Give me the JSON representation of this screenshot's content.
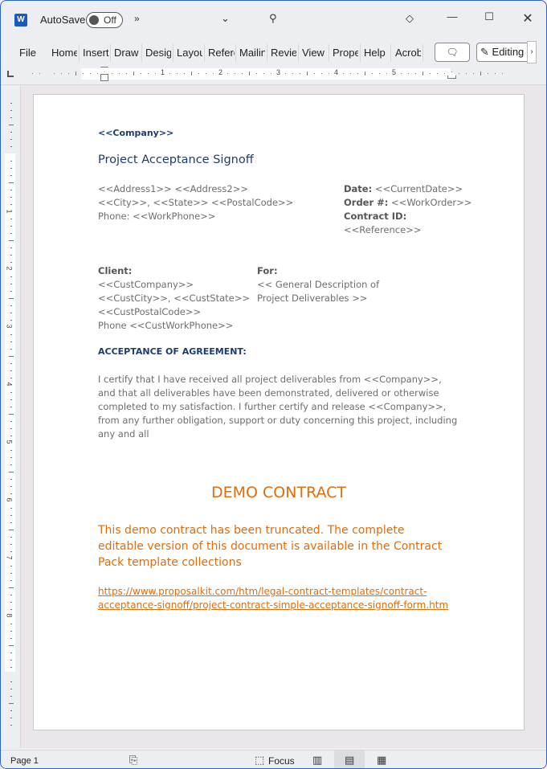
{
  "titlebar": {
    "app_icon": "word-icon",
    "app_icon_glyph": "W",
    "autosave_label": "AutoSave",
    "autosave_state": "Off",
    "more_glyph": "»",
    "chevron_glyph": "⌄",
    "search_glyph": "⚲",
    "diamond_glyph": "◇",
    "minimize_glyph": "—",
    "maximize_glyph": "☐",
    "close_glyph": "✕"
  },
  "ribbon": {
    "tabs": [
      "File",
      "Home",
      "Insert",
      "Draw",
      "Design",
      "Layout",
      "References",
      "Mailings",
      "Review",
      "View",
      "Properties",
      "Help",
      "Acrobat"
    ],
    "comment_glyph": "🗨",
    "editing_label": "Editing",
    "editing_glyph": "✎",
    "scroll_glyph": "›"
  },
  "ruler": {
    "h_numbers": [
      "1",
      "2",
      "3",
      "4",
      "5"
    ],
    "v_numbers": [
      "1",
      "2",
      "3",
      "4",
      "5",
      "6",
      "7",
      "8"
    ]
  },
  "document": {
    "company": "<<Company>>",
    "title": "Project Acceptance Signoff",
    "address": {
      "line1": "<<Address1>> <<Address2>>",
      "line2": "<<City>>, <<State>> <<PostalCode>>",
      "line3": "Phone: <<WorkPhone>>"
    },
    "meta": {
      "date_label": "Date:",
      "date_value": " <<CurrentDate>>",
      "order_label": "Order #:",
      "order_value": " <<WorkOrder>>",
      "contract_label": "Contract ID:",
      "contract_value": "<<Reference>>"
    },
    "client": {
      "label": "Client:",
      "line1": "<<CustCompany>>",
      "line2": "<<CustCity>>, <<CustState>>",
      "line3": "<<CustPostalCode>>",
      "line4": "Phone <<CustWorkPhone>>"
    },
    "for": {
      "label": "For:",
      "line1": "<< General Description of",
      "line2": "Project Deliverables >>"
    },
    "acceptance_heading": "ACCEPTANCE OF AGREEMENT:",
    "body": "I certify that I have received all project deliverables from <<Company>>, and that all deliverables have been demonstrated, delivered or otherwise completed to my satisfaction. I further certify and release <<Company>>, from any further obligation, support or duty concerning this project, including any and all",
    "demo_title": "DEMO CONTRACT",
    "demo_text": "This demo contract has been truncated. The complete editable version of this document is available in the Contract Pack template collections",
    "demo_link": "https://www.proposalkit.com/htm/legal-contract-templates/contract-acceptance-signoff/project-contract-simple-acceptance-signoff-form.htm"
  },
  "statusbar": {
    "page": "Page 1",
    "track_glyph": "⎘",
    "focus_glyph": "⬚",
    "focus_label": "Focus",
    "read_mode_glyph": "▥",
    "print_layout_glyph": "▤",
    "web_layout_glyph": "▦"
  },
  "colors": {
    "heading_blue": "#1f3b6e",
    "demo_orange": "#e36c0a",
    "body_gray": "#6d6d6d",
    "window_border": "#2a64c9"
  }
}
